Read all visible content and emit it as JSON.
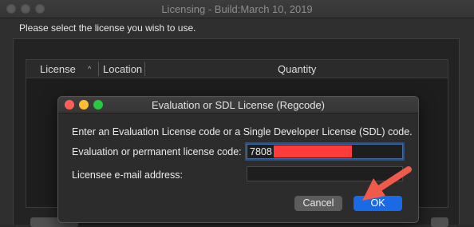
{
  "window": {
    "title": "Licensing - Build:March 10, 2019",
    "instruction": "Please select the license you wish to use."
  },
  "table": {
    "columns": [
      "License",
      "Location",
      "Quantity"
    ],
    "sort_indicator": "^"
  },
  "dialog": {
    "title": "Evaluation or SDL License (Regcode)",
    "prompt": "Enter an Evaluation License code or a Single Developer License (SDL) code.",
    "license_code_label": "Evaluation or permanent license code:",
    "license_code_value": "7808",
    "email_label": "Licensee e-mail address:",
    "email_value": "",
    "cancel_label": "Cancel",
    "ok_label": "OK"
  },
  "colors": {
    "ok_button": "#1a6ae6",
    "annotation_arrow": "#f05a4a",
    "redaction": "#ff3b3b"
  },
  "icons": [
    "window-close-icon",
    "window-minimize-icon",
    "window-zoom-icon",
    "sort-arrow-icon",
    "annotation-arrow-icon"
  ]
}
